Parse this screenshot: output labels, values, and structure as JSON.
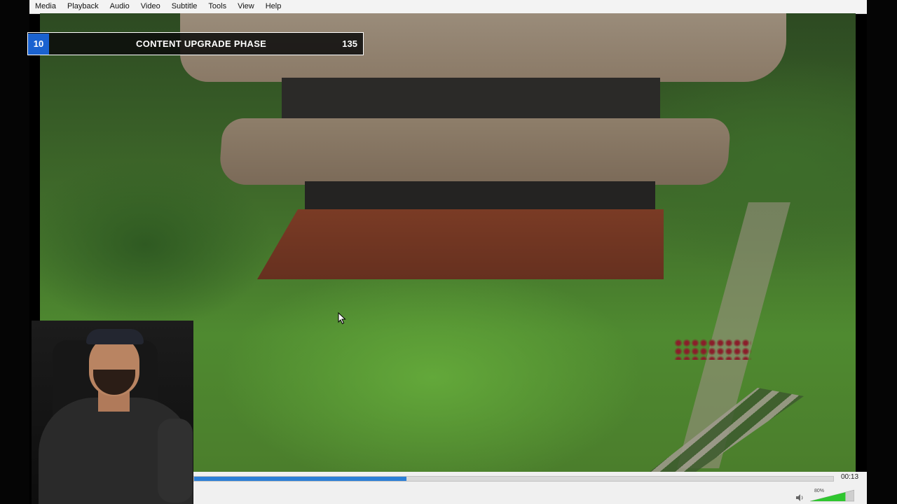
{
  "menu": {
    "items": [
      "Media",
      "Playback",
      "Audio",
      "Video",
      "Subtitle",
      "Tools",
      "View",
      "Help"
    ]
  },
  "overlay": {
    "number": "10",
    "title": "CONTENT UPGRADE PHASE",
    "count": "135",
    "accent_color": "#1a62d0"
  },
  "player": {
    "elapsed_fraction": 0.332,
    "time_display": "00:13",
    "volume_label": "80%",
    "volume_fraction": 0.8,
    "seek_color": "#2c7fd7",
    "volume_color": "#2fc62f"
  },
  "icons": {
    "cursor": "mouse-pointer-icon",
    "speaker": "speaker-icon"
  }
}
